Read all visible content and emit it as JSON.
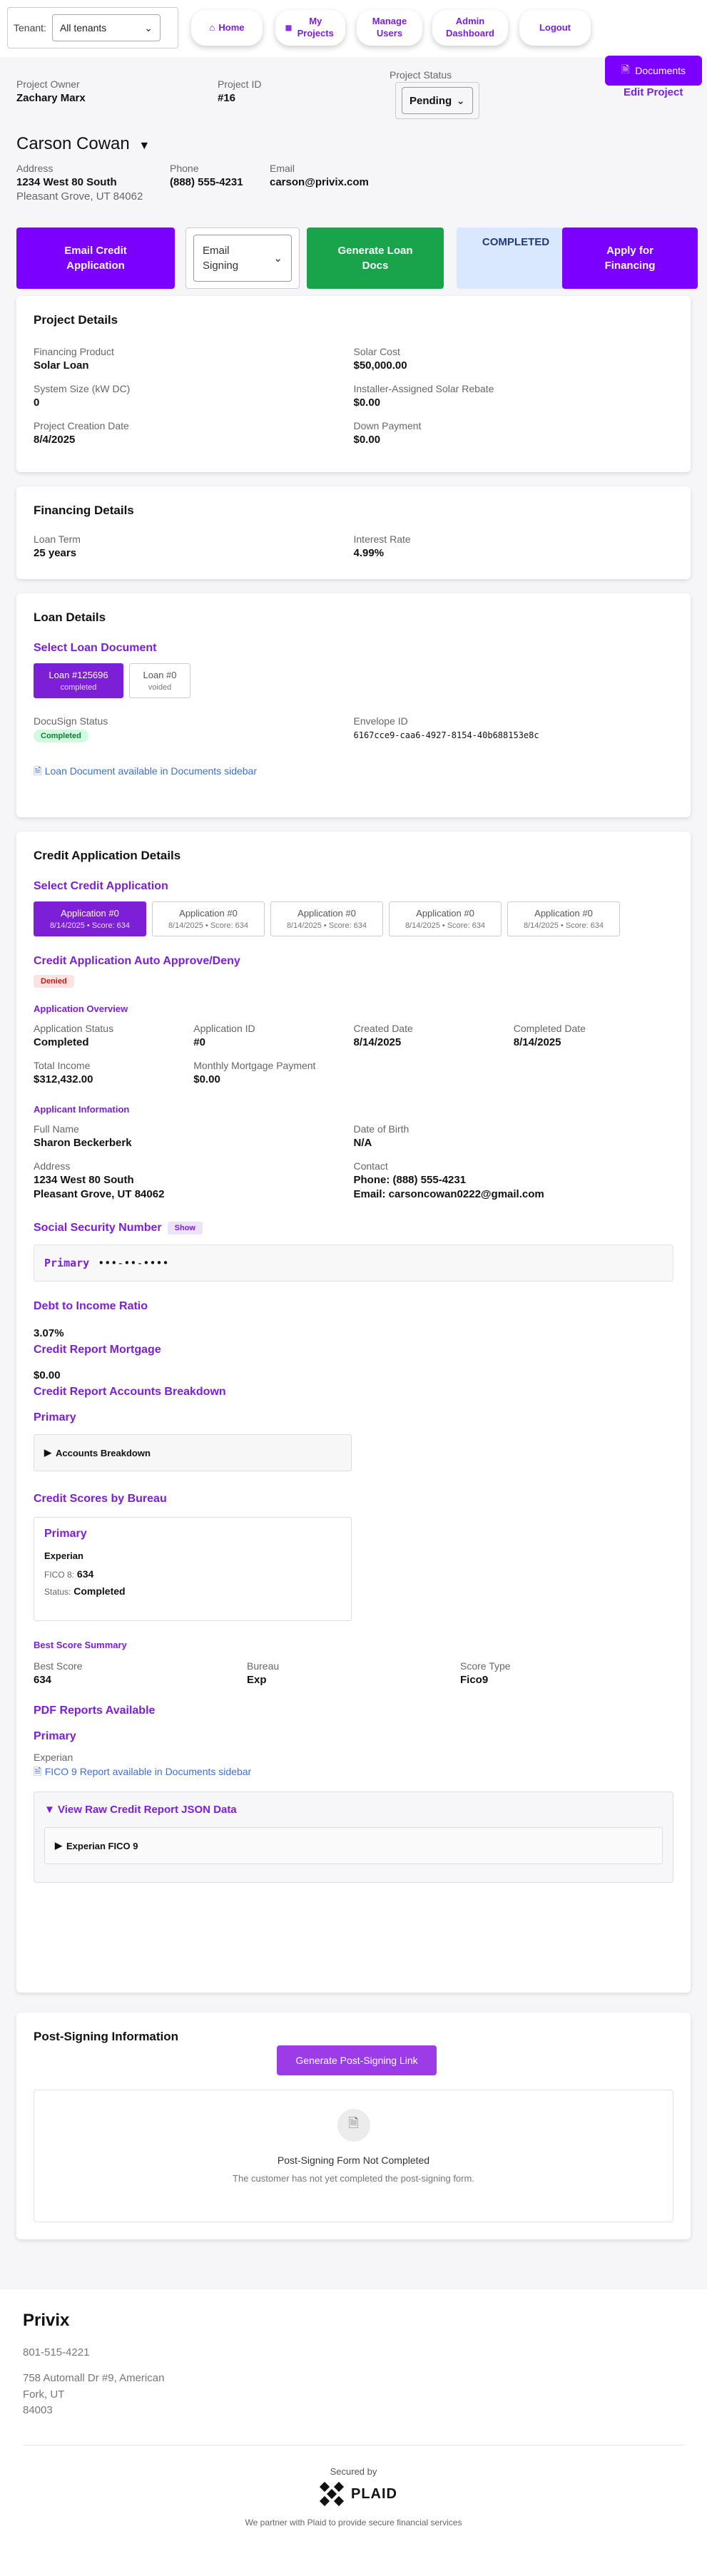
{
  "nav": {
    "tenant_label": "Tenant:",
    "tenant_value": "All tenants",
    "home": "Home",
    "my_projects": "My Projects",
    "manage_users": "Manage Users",
    "admin_dashboard": "Admin Dashboard",
    "logout": "Logout"
  },
  "header": {
    "documents": "Documents",
    "edit_project": "Edit Project",
    "owner_label": "Project Owner",
    "owner_value": "Zachary Marx",
    "id_label": "Project ID",
    "id_value": "#16",
    "status_label": "Project Status",
    "status_value": "Pending"
  },
  "customer": {
    "name": "Carson Cowan",
    "address_label": "Address",
    "address_line1": "1234 West 80 South",
    "address_line2": "Pleasant Grove, UT 84062",
    "phone_label": "Phone",
    "phone_value": "(888) 555-4231",
    "email_label": "Email",
    "email_value": "carson@privix.com"
  },
  "actions": {
    "email_credit": "Email Credit Application",
    "email_signing": "Email Signing",
    "generate_docs": "Generate Loan Docs",
    "completed": "COMPLETED",
    "apply_financing": "Apply for Financing"
  },
  "project_details": {
    "title": "Project Details",
    "fields": [
      {
        "label": "Financing Product",
        "value": "Solar Loan"
      },
      {
        "label": "Solar Cost",
        "value": "$50,000.00"
      },
      {
        "label": "System Size (kW DC)",
        "value": "0"
      },
      {
        "label": "Installer-Assigned Solar Rebate",
        "value": "$0.00"
      },
      {
        "label": "Project Creation Date",
        "value": "8/4/2025"
      },
      {
        "label": "Down Payment",
        "value": "$0.00"
      }
    ]
  },
  "financing_details": {
    "title": "Financing Details",
    "fields": [
      {
        "label": "Loan Term",
        "value": "25 years"
      },
      {
        "label": "Interest Rate",
        "value": "4.99%"
      }
    ]
  },
  "loan_details": {
    "title": "Loan Details",
    "select_label": "Select Loan Document",
    "loans": [
      {
        "title": "Loan #125696",
        "status": "completed"
      },
      {
        "title": "Loan #0",
        "status": "voided"
      }
    ],
    "docusign_label": "DocuSign Status",
    "docusign_value": "Completed",
    "envelope_label": "Envelope ID",
    "envelope_value": "6167cce9-caa6-4927-8154-40b688153e8c",
    "doc_note": "Loan Document available in Documents sidebar"
  },
  "credit": {
    "title": "Credit Application Details",
    "select_label": "Select Credit Application",
    "apps": [
      {
        "title": "Application #0",
        "sub": "8/14/2025 • Score: 634"
      },
      {
        "title": "Application #0",
        "sub": "8/14/2025 • Score: 634"
      },
      {
        "title": "Application #0",
        "sub": "8/14/2025 • Score: 634"
      },
      {
        "title": "Application #0",
        "sub": "8/14/2025 • Score: 634"
      },
      {
        "title": "Application #0",
        "sub": "8/14/2025 • Score: 634"
      }
    ],
    "auto_title": "Credit Application Auto Approve/Deny",
    "auto_badge": "Denied",
    "overview_title": "Application Overview",
    "overview": [
      {
        "label": "Application Status",
        "value": "Completed"
      },
      {
        "label": "Application ID",
        "value": "#0"
      },
      {
        "label": "Created Date",
        "value": "8/14/2025"
      },
      {
        "label": "Completed Date",
        "value": "8/14/2025"
      },
      {
        "label": "Total Income",
        "value": "$312,432.00"
      },
      {
        "label": "Monthly Mortgage Payment",
        "value": "$0.00"
      }
    ],
    "applicant_title": "Applicant Information",
    "full_name_label": "Full Name",
    "full_name_value": "Sharon Beckerberk",
    "dob_label": "Date of Birth",
    "dob_value": "N/A",
    "address_label": "Address",
    "address_line1": "1234 West 80 South",
    "address_line2": "Pleasant Grove, UT 84062",
    "contact_label": "Contact",
    "contact_phone": "Phone: (888) 555-4231",
    "contact_email": "Email: carsoncowan0222@gmail.com",
    "ssn_title": "Social Security Number",
    "ssn_show": "Show",
    "ssn_primary": "Primary",
    "ssn_masked": "•••-••-••••",
    "dti_title": "Debt to Income Ratio",
    "dti_value": "3.07%",
    "mortgage_title": "Credit Report Mortgage",
    "mortgage_value": "$0.00",
    "accounts_title": "Credit Report Accounts Breakdown",
    "accounts_primary": "Primary",
    "accounts_toggle": "Accounts Breakdown",
    "bureau_title": "Credit Scores by Bureau",
    "bureau_primary": "Primary",
    "bureau_name": "Experian",
    "fico_label": "FICO 8:",
    "fico_value": "634",
    "status_label": "Status:",
    "status_value": "Completed",
    "best_title": "Best Score Summary",
    "best": [
      {
        "label": "Best Score",
        "value": "634"
      },
      {
        "label": "Bureau",
        "value": "Exp"
      },
      {
        "label": "Score Type",
        "value": "Fico9"
      }
    ],
    "pdf_title": "PDF Reports Available",
    "pdf_primary": "Primary",
    "pdf_bureau": "Experian",
    "pdf_link": "FICO 9 Report available in Documents sidebar",
    "raw_title": "View Raw Credit Report JSON Data",
    "raw_item": "Experian FICO 9"
  },
  "post_signing": {
    "title": "Post-Signing Information",
    "button": "Generate Post-Signing Link",
    "empty_title": "Post-Signing Form Not Completed",
    "empty_sub": "The customer has not yet completed the post-signing form."
  },
  "footer": {
    "company": "Privix",
    "phone": "801-515-4221",
    "addr1": "758 Automall Dr #9, American",
    "addr2": "Fork, UT",
    "addr3": "84003",
    "secured_by": "Secured by",
    "plaid": "PLAID",
    "partner_note": "We partner with Plaid to provide secure financial services"
  }
}
